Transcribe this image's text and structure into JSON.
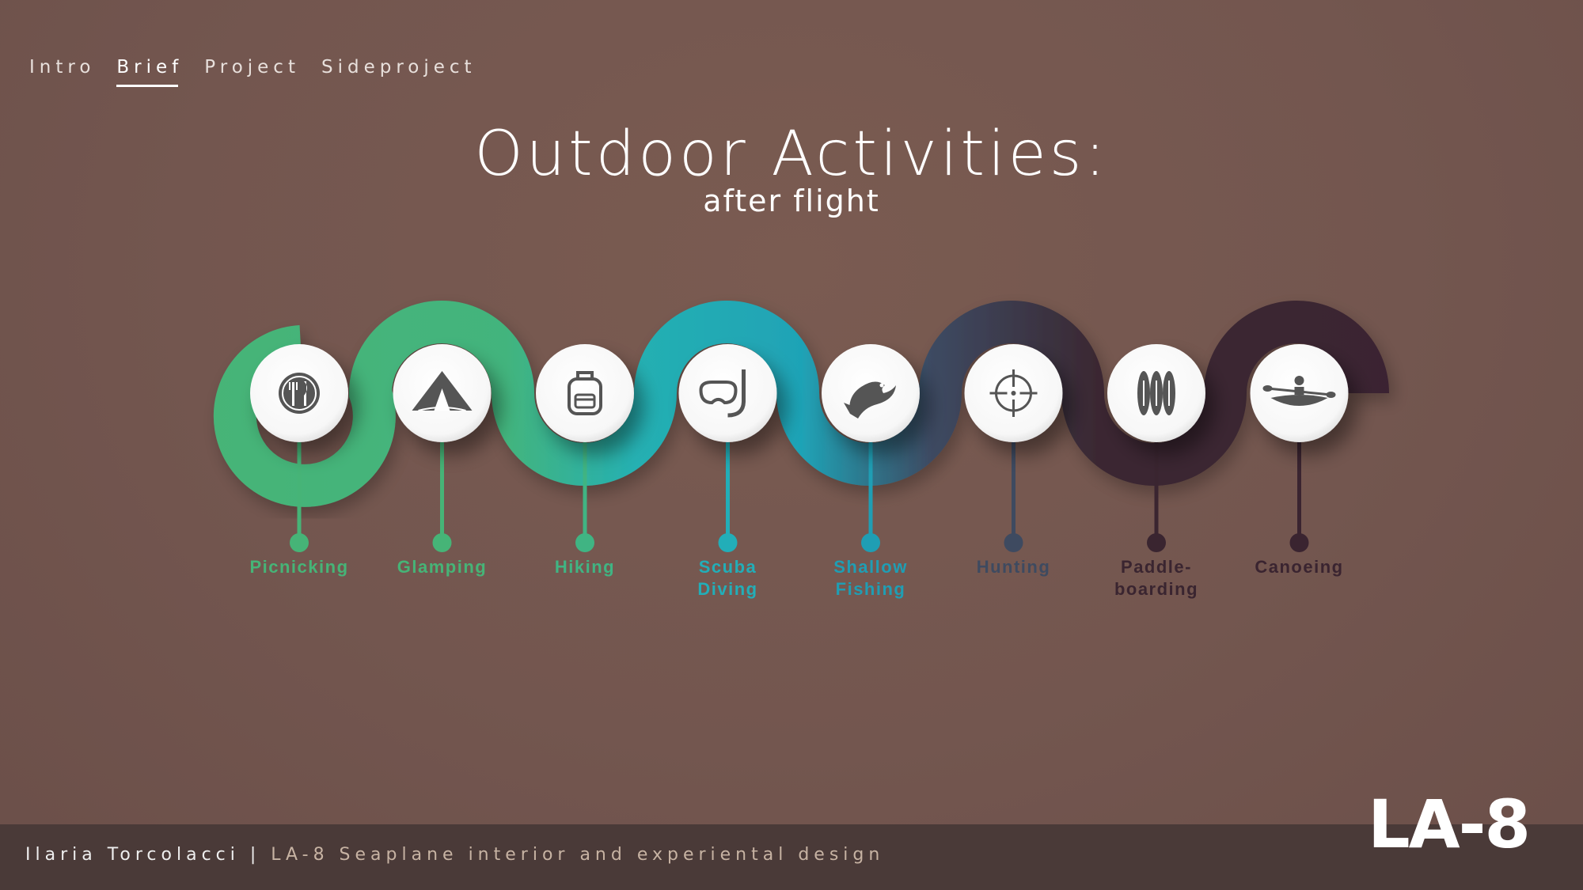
{
  "nav": {
    "items": [
      {
        "label": "Intro",
        "active": false
      },
      {
        "label": "Brief",
        "active": true
      },
      {
        "label": "Project",
        "active": false
      },
      {
        "label": "Sideproject",
        "active": false
      }
    ]
  },
  "header": {
    "title": "Outdoor Activities:",
    "subtitle": "after flight"
  },
  "activities": [
    {
      "label_lines": [
        "Picnicking"
      ],
      "icon": "plate-fork-knife-icon",
      "color": "#46b477"
    },
    {
      "label_lines": [
        "Glamping"
      ],
      "icon": "tent-icon",
      "color": "#46b477"
    },
    {
      "label_lines": [
        "Hiking"
      ],
      "icon": "backpack-icon",
      "color": "#40b483"
    },
    {
      "label_lines": [
        "Scuba",
        "Diving"
      ],
      "icon": "snorkel-mask-icon",
      "color": "#22aeb8"
    },
    {
      "label_lines": [
        "Shallow",
        "Fishing"
      ],
      "icon": "fish-icon",
      "color": "#1f9eb4"
    },
    {
      "label_lines": [
        "Hunting"
      ],
      "icon": "crosshair-icon",
      "color": "#3e4a60"
    },
    {
      "label_lines": [
        "Paddle-",
        "boarding"
      ],
      "icon": "paddleboards-icon",
      "color": "#3a2530"
    },
    {
      "label_lines": [
        "Canoeing"
      ],
      "icon": "kayak-icon",
      "color": "#3a2430"
    }
  ],
  "colors": {
    "green": "#46b477",
    "teal": "#22aeb8",
    "navy": "#3e4a60",
    "plum": "#3a2530",
    "background": "#73564f",
    "footer": "#4a3a38"
  },
  "footer": {
    "author": "Ilaria Torcolacci",
    "separator": " | ",
    "project": "LA-8 Seaplane interior and experiental design"
  },
  "logo": {
    "text": "LA-8"
  }
}
